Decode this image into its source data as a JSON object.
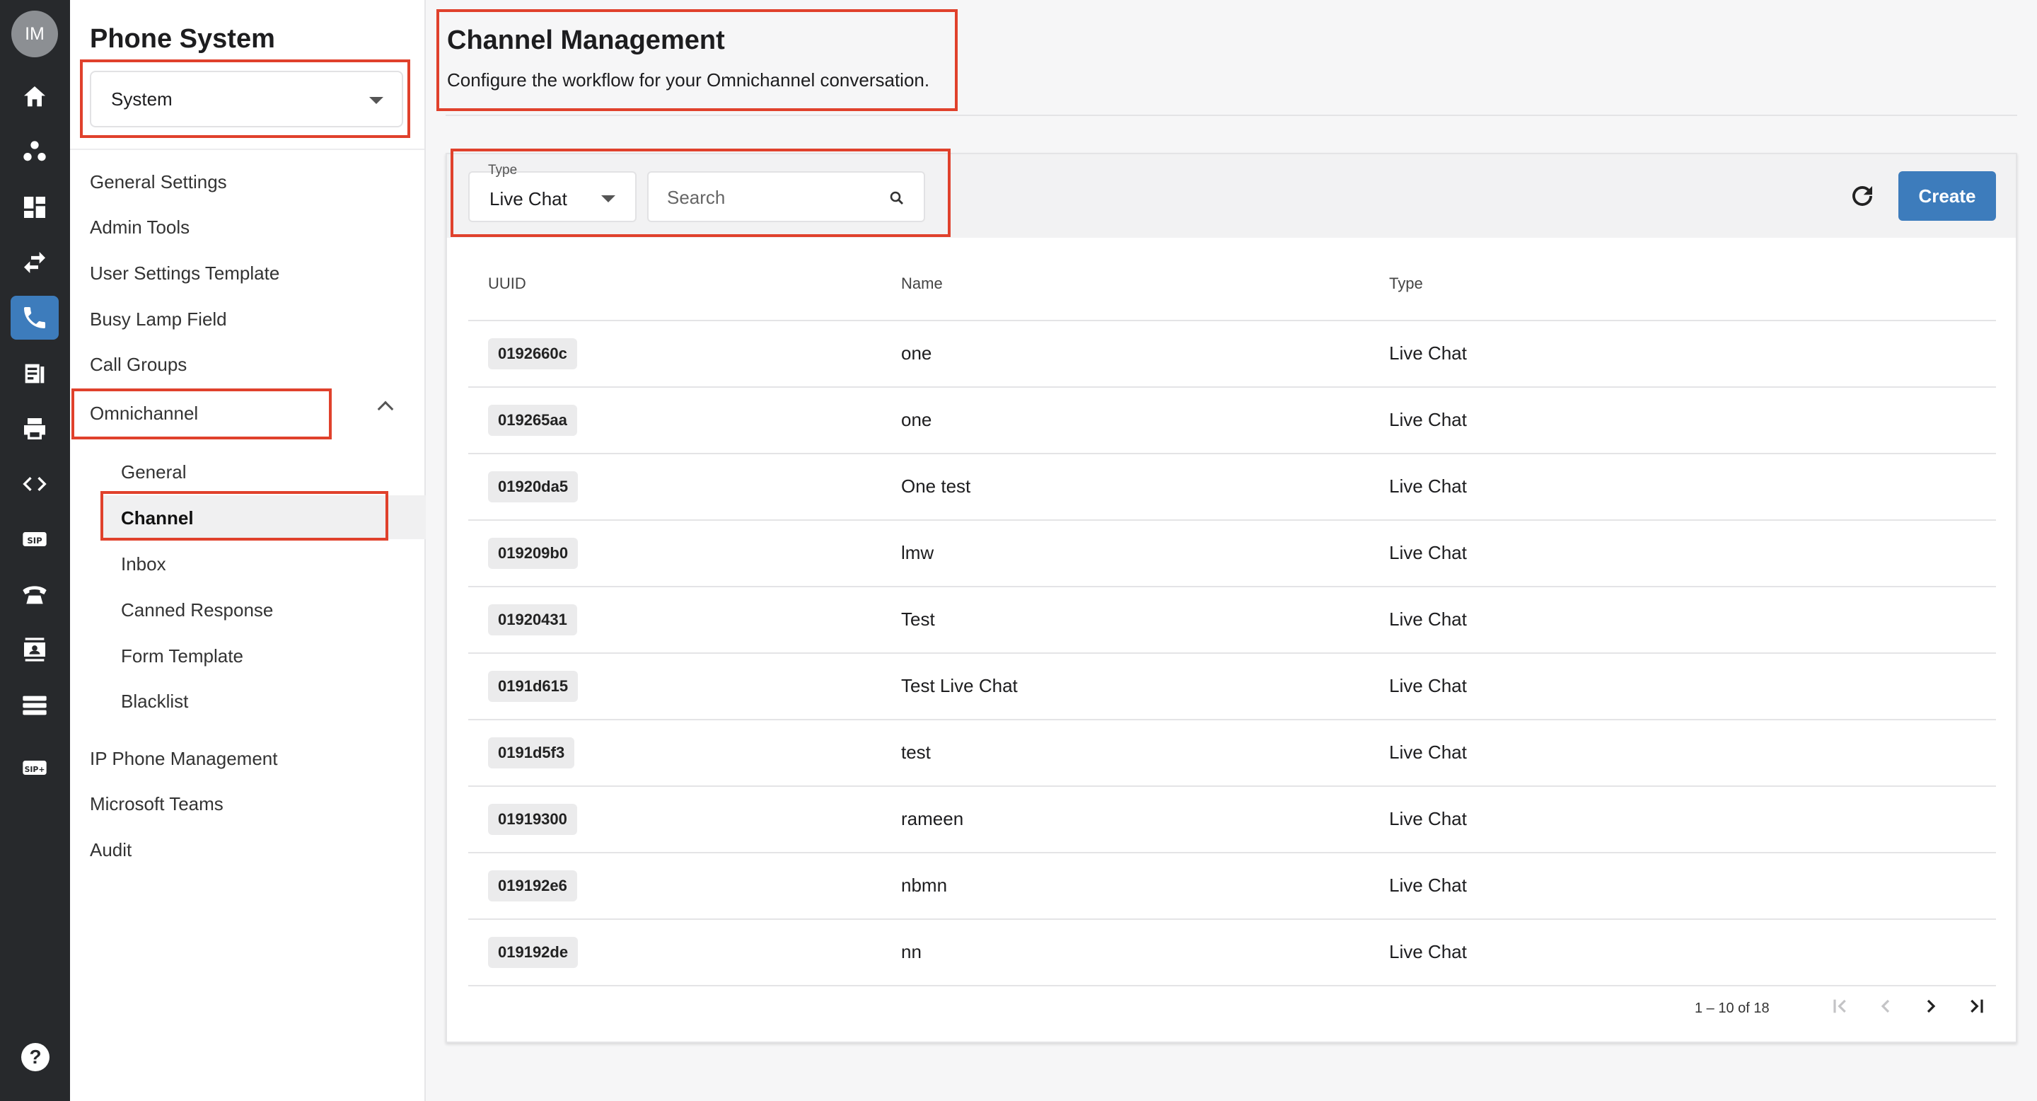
{
  "rail": {
    "avatar_initials": "IM",
    "items": [
      "home-icon",
      "org-chart-icon",
      "dashboard-icon",
      "transfer-icon",
      "phone-icon",
      "fax-icon",
      "printer-icon",
      "code-icon",
      "sip-icon",
      "telephone-icon",
      "contacts-icon",
      "server-icon",
      "sip-plus-icon"
    ],
    "active_item": "phone-icon",
    "help_label": "?",
    "accent_color": "#3d7cbc"
  },
  "sidebar": {
    "title": "Phone System",
    "scope_select": "System",
    "items": {
      "general_settings": "General Settings",
      "admin_tools": "Admin Tools",
      "user_settings_template": "User Settings Template",
      "busy_lamp_field": "Busy Lamp Field",
      "call_groups": "Call Groups",
      "omnichannel": "Omnichannel",
      "ip_phone_management": "IP Phone Management",
      "microsoft_teams": "Microsoft Teams",
      "audit": "Audit"
    },
    "omnichannel_sub": {
      "general": "General",
      "channel": "Channel",
      "inbox": "Inbox",
      "canned_response": "Canned Response",
      "form_template": "Form Template",
      "blacklist": "Blacklist"
    }
  },
  "header": {
    "title": "Channel Management",
    "subtitle": "Configure the workflow for your Omnichannel conversation."
  },
  "toolbar": {
    "type_label": "Type",
    "type_value": "Live Chat",
    "search_placeholder": "Search",
    "create_label": "Create"
  },
  "table": {
    "headers": {
      "uuid": "UUID",
      "name": "Name",
      "type": "Type"
    },
    "rows": [
      {
        "uuid": "0192660c",
        "name": "one",
        "type": "Live Chat"
      },
      {
        "uuid": "019265aa",
        "name": "one",
        "type": "Live Chat"
      },
      {
        "uuid": "01920da5",
        "name": "One test",
        "type": "Live Chat"
      },
      {
        "uuid": "019209b0",
        "name": "lmw",
        "type": "Live Chat"
      },
      {
        "uuid": "01920431",
        "name": "Test",
        "type": "Live Chat"
      },
      {
        "uuid": "0191d615",
        "name": "Test Live Chat",
        "type": "Live Chat"
      },
      {
        "uuid": "0191d5f3",
        "name": "test",
        "type": "Live Chat"
      },
      {
        "uuid": "01919300",
        "name": "rameen",
        "type": "Live Chat"
      },
      {
        "uuid": "019192e6",
        "name": "nbmn",
        "type": "Live Chat"
      },
      {
        "uuid": "019192de",
        "name": "nn",
        "type": "Live Chat"
      }
    ]
  },
  "pagination": {
    "range_text": "1 – 10 of 18"
  },
  "highlight_color": "#e0412c"
}
